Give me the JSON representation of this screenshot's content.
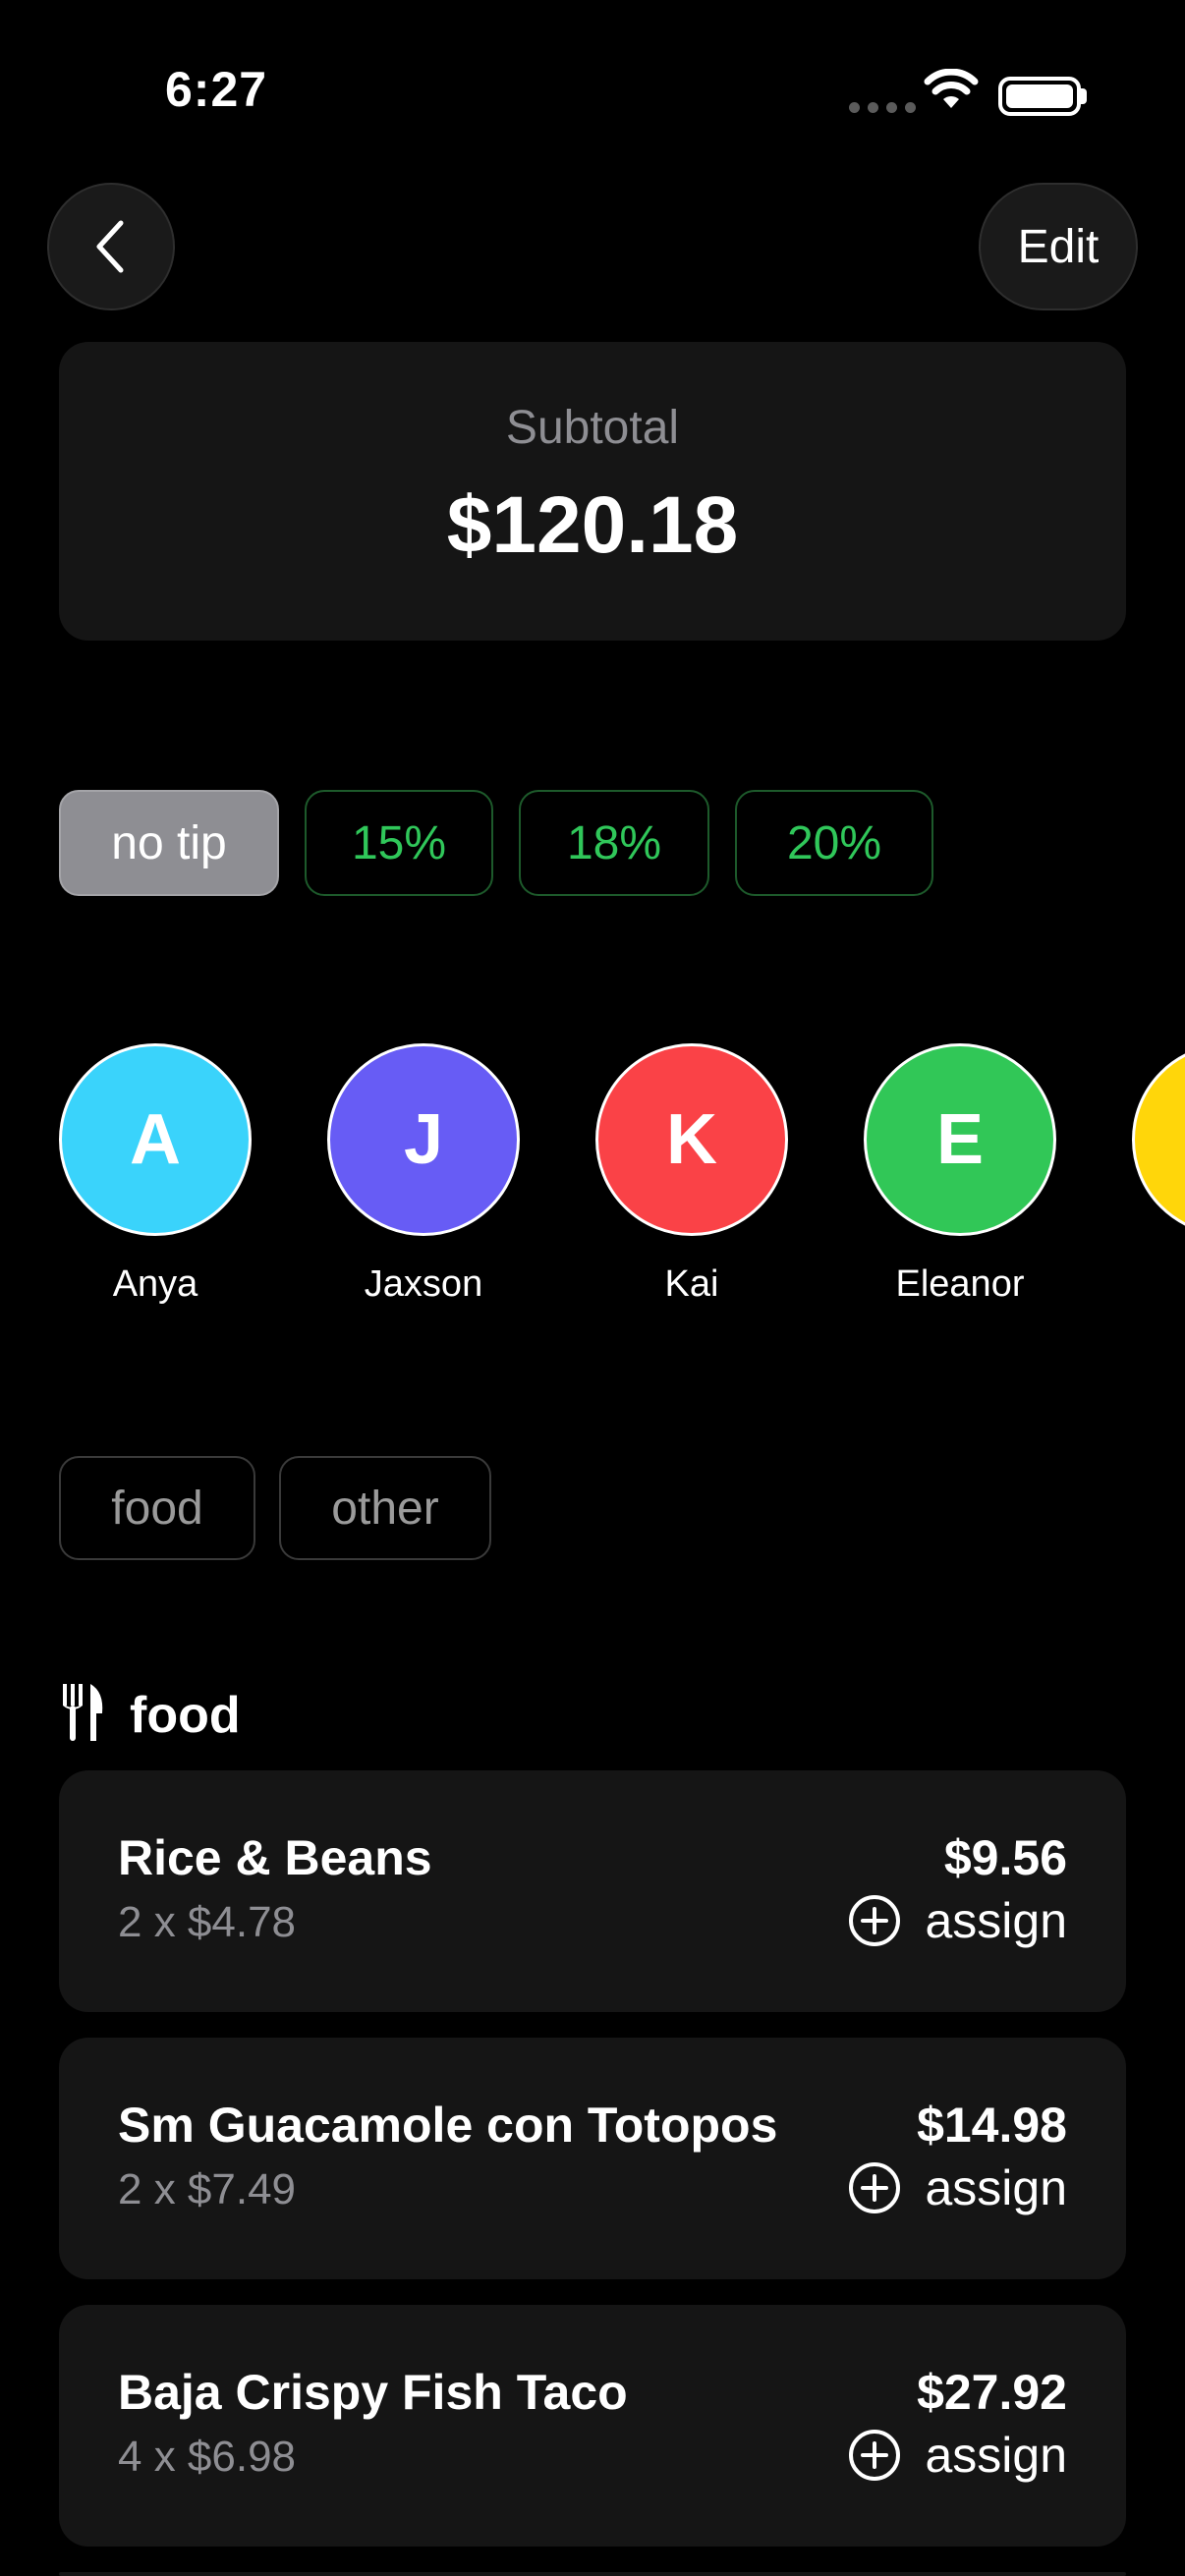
{
  "status_bar": {
    "time": "6:27"
  },
  "nav": {
    "back_icon": "chevron-left-icon",
    "edit_label": "Edit"
  },
  "subtotal": {
    "label": "Subtotal",
    "value": "$120.18"
  },
  "tips": [
    {
      "label": "no tip",
      "selected": true
    },
    {
      "label": "15%",
      "selected": false
    },
    {
      "label": "18%",
      "selected": false
    },
    {
      "label": "20%",
      "selected": false
    }
  ],
  "people": [
    {
      "initial": "A",
      "name": "Anya",
      "color": "#3ad3fb"
    },
    {
      "initial": "J",
      "name": "Jaxson",
      "color": "#675cf5"
    },
    {
      "initial": "K",
      "name": "Kai",
      "color": "#fa4247"
    },
    {
      "initial": "E",
      "name": "Eleanor",
      "color": "#31c757"
    },
    {
      "initial": "",
      "name": "",
      "color": "#ffd60a"
    }
  ],
  "filters": [
    "food",
    "other"
  ],
  "section": {
    "icon": "fork-knife-icon",
    "title": "food"
  },
  "items": [
    {
      "name": "Rice & Beans",
      "qty": "2 x $4.78",
      "price": "$9.56",
      "assign_label": "assign"
    },
    {
      "name": "Sm Guacamole con Totopos",
      "qty": "2 x $7.49",
      "price": "$14.98",
      "assign_label": "assign"
    },
    {
      "name": "Baja Crispy Fish Taco",
      "qty": "4 x $6.98",
      "price": "$27.92",
      "assign_label": "assign"
    }
  ]
}
